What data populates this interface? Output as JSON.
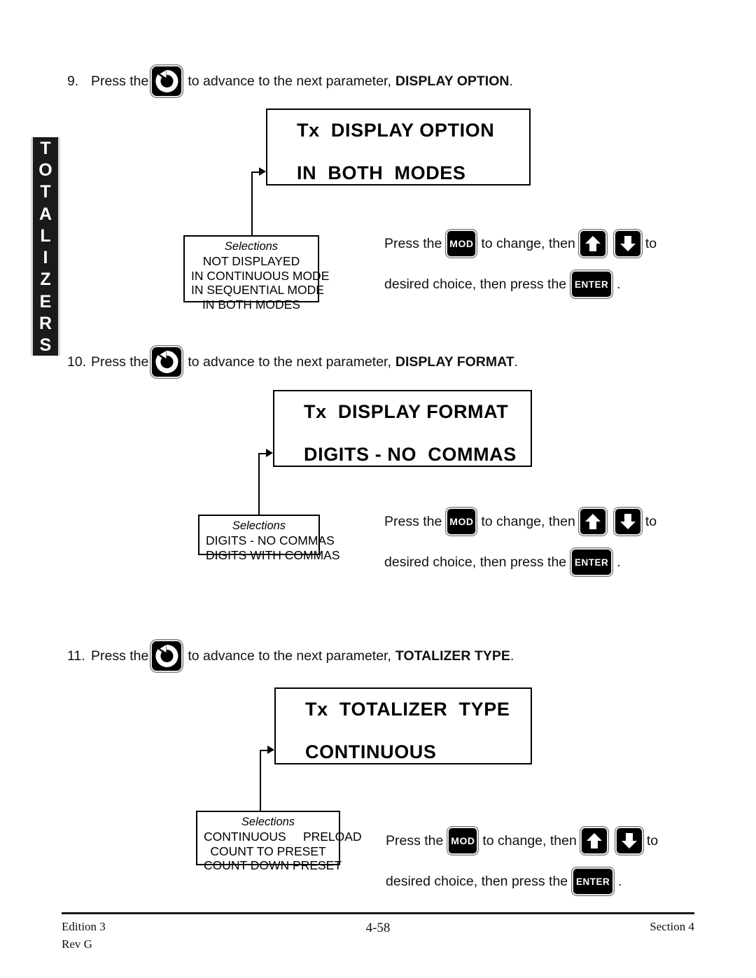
{
  "side_tab": {
    "label": "TOTALIZERS",
    "letters": [
      "T",
      "O",
      "T",
      "A",
      "L",
      "I",
      "Z",
      "E",
      "R",
      "S"
    ],
    "background": "#1a1a1a",
    "text_color": "#ffffff"
  },
  "keys": {
    "advance": "advance-key-icon",
    "mod": "MOD",
    "up": "up-arrow-icon",
    "down": "down-arrow-icon",
    "enter": "ENTER"
  },
  "instruction_block": {
    "line1_a": "Press the",
    "line1_b": "to change, then",
    "line1_c": "to",
    "line2_a": "desired choice, then press the",
    "line2_b": "."
  },
  "steps": [
    {
      "number": "9.",
      "text_before": "Press the",
      "text_after": "to advance to the next parameter,",
      "parameter": "DISPLAY OPTION",
      "period": "."
    },
    {
      "number": "10.",
      "text_before": "Press the",
      "text_after": "to advance to the next parameter,",
      "parameter": "DISPLAY FORMAT",
      "period": "."
    },
    {
      "number": "11.",
      "text_before": "Press the",
      "text_after": "to advance to the next parameter,",
      "parameter": "TOTALIZER TYPE",
      "period": "."
    }
  ],
  "displays": [
    {
      "line1": "Tx  DISPLAY OPTION",
      "line2": "IN  BOTH  MODES"
    },
    {
      "line1": "Tx  DISPLAY FORMAT",
      "line2": "DIGITS - NO  COMMAS"
    },
    {
      "line1": "Tx  TOTALIZER  TYPE",
      "line2": "CONTINUOUS"
    }
  ],
  "selections": [
    {
      "title": "Selections",
      "items": [
        "NOT DISPLAYED",
        "IN CONTINUOUS MODE",
        "IN SEQUENTIAL MODE",
        "IN BOTH MODES"
      ]
    },
    {
      "title": "Selections",
      "items": [
        "DIGITS - NO COMMAS",
        "DIGITS WITH COMMAS"
      ]
    },
    {
      "title": "Selections",
      "items": [
        "CONTINUOUS     PRELOAD",
        "COUNT TO PRESET",
        "COUNT DOWN PRESET"
      ]
    }
  ],
  "footer": {
    "edition": "Edition 3",
    "revision": "Rev G",
    "page_number": "4-58",
    "section": "Section 4"
  }
}
